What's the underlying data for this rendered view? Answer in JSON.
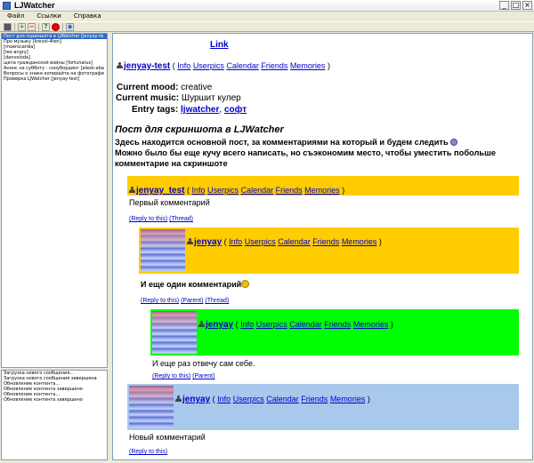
{
  "window": {
    "title": "LJWatcher",
    "minimize": "_",
    "maximize": "□",
    "close": "×"
  },
  "menu": [
    "Файл",
    "Ссылки",
    "Справка"
  ],
  "toolbar": {
    "items": [
      "save-icon",
      "add-icon",
      "remove-icon",
      "help-icon",
      "stop-icon",
      "view-icon"
    ],
    "glyphs": {
      "add": "+",
      "remove": "−",
      "help": "?",
      "view": "◉"
    }
  },
  "posts_list": [
    "Пост для скриншота в LJWatcher [jenyay-te",
    "Про музыку [krevoi-4ten]",
    "[moerocardia]",
    "[leo-angry]",
    "[danvoloda]",
    "щета гражданской войны [fortunatus]",
    "Анонс на субботу - сноубординг [alexk-aba",
    "Вопросы о знаке копирайта на фотографи",
    "Проверка LJWatcher [jenyay-test]"
  ],
  "log": [
    "Загрузка нового сообщения...",
    "Загрузка нового сообщения завершена",
    "Обновление контента...",
    "Обновление контента завершено",
    "Обновление контента...",
    "Обновление контента завершено"
  ],
  "post": {
    "top_link": "Link",
    "user": "jenyay-test",
    "links": [
      "Info",
      "Userpics",
      "Calendar",
      "Friends",
      "Memories"
    ],
    "mood_label": "Current mood:",
    "mood": "creative",
    "music_label": "Current music:",
    "music": "Шуршит кулер",
    "tags_label": "Entry tags:",
    "tags": [
      "ljwatcher",
      "софт"
    ],
    "subject": "Пост для скриншота в LJWatcher",
    "body_1": "Здесь находится основной пост, за комментариями на который и будем следить",
    "body_2": "Можно было бы еще кучу всего написать, но съэкономим место, чтобы уместить побольше комментарие на скриншоте"
  },
  "comments": [
    {
      "user": "jenyay_test",
      "text": "Первый комментарий",
      "links": [
        "(Reply to this)",
        "(Thread)"
      ],
      "color": "#ffcc00"
    },
    {
      "user": "jenyay",
      "text": "И еще один комментарий",
      "links": [
        "(Reply to this)",
        "(Parent)",
        "(Thread)"
      ],
      "color": "#ffcc00"
    },
    {
      "user": "jenyay",
      "text": "И еще раз отвечу сам себе.",
      "links": [
        "(Reply to this)",
        "(Parent)"
      ],
      "color": "#00ff00"
    },
    {
      "user": "jenyay",
      "text": "Новый комментарий",
      "links": [
        "(Reply to this)"
      ],
      "color": "#a8c8ec"
    }
  ],
  "separators": {
    "open": "(",
    "close": ")",
    "comma": ","
  }
}
